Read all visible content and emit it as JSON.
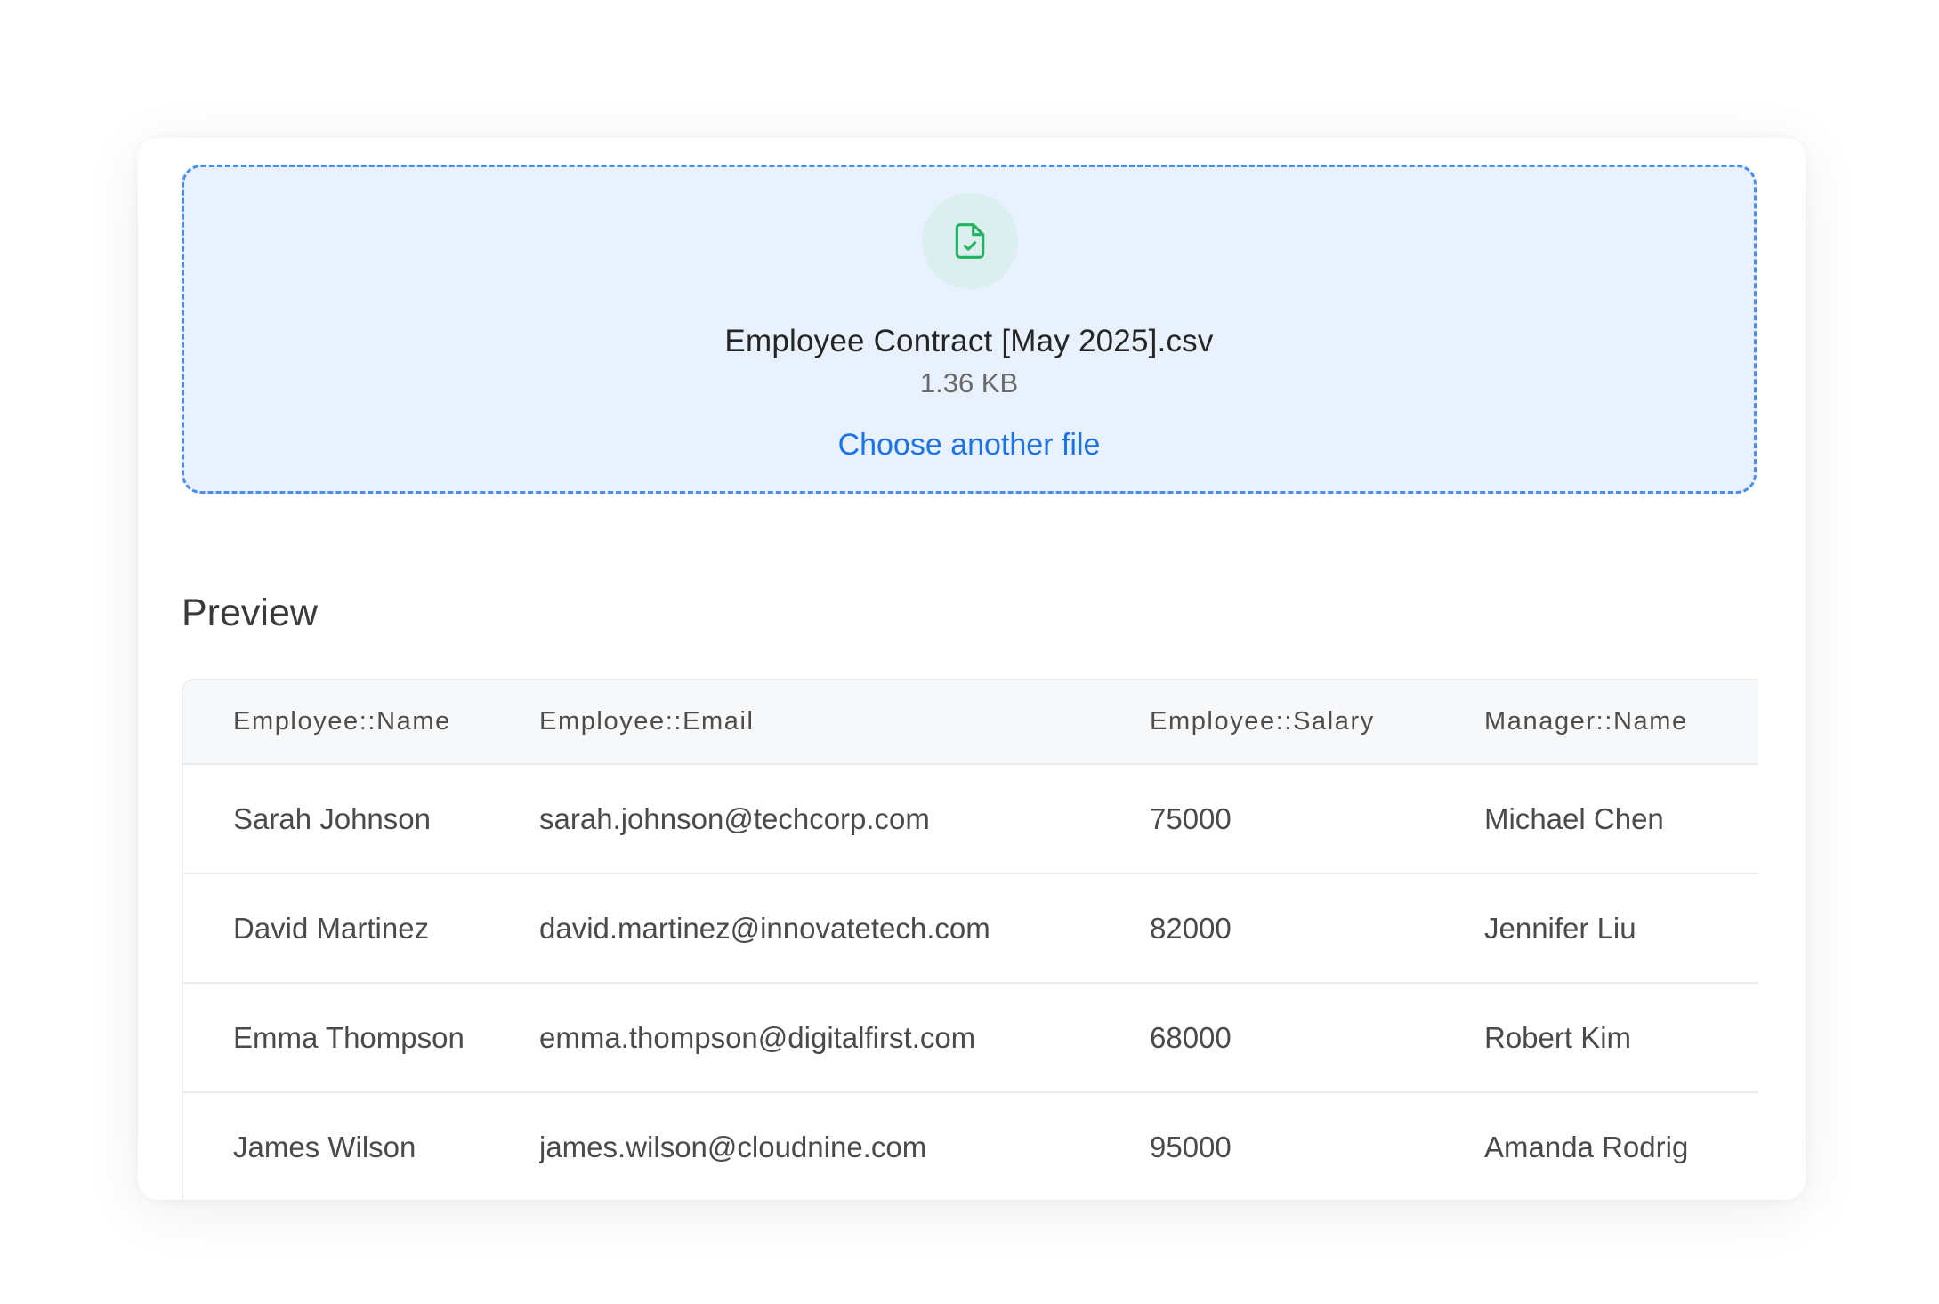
{
  "upload": {
    "icon": "file-check-icon",
    "icon_color": "#22b35e",
    "file_name": "Employee Contract [May 2025].csv",
    "file_size": "1.36 KB",
    "choose_label": "Choose another file",
    "accent_color": "#1a73e8"
  },
  "preview": {
    "title": "Preview",
    "columns": [
      "Employee::Name",
      "Employee::Email",
      "Employee::Salary",
      "Manager::Name"
    ],
    "rows": [
      [
        "Sarah Johnson",
        "sarah.johnson@techcorp.com",
        "75000",
        "Michael Chen"
      ],
      [
        "David Martinez",
        "david.martinez@innovatetech.com",
        "82000",
        "Jennifer Liu"
      ],
      [
        "Emma Thompson",
        "emma.thompson@digitalfirst.com",
        "68000",
        "Robert Kim"
      ],
      [
        "James Wilson",
        "james.wilson@cloudnine.com",
        "95000",
        "Amanda Rodrig"
      ]
    ]
  }
}
